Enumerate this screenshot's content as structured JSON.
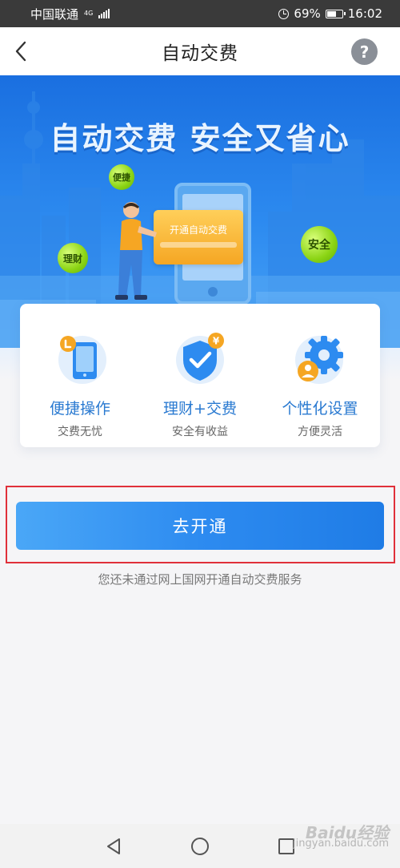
{
  "status_bar": {
    "carrier": "中国联通",
    "network": "4G",
    "battery": "69%",
    "battery_level": 0.69,
    "time": "16:02"
  },
  "header": {
    "title": "自动交费",
    "help_symbol": "?"
  },
  "hero": {
    "headline": "自动交费 安全又省心",
    "card_text": "开通自动交费",
    "bubbles": {
      "convenient": "便捷",
      "finance": "理财",
      "safe": "安全"
    }
  },
  "features": [
    {
      "title": "便捷操作",
      "subtitle": "交费无忧",
      "icon": "phone-icon"
    },
    {
      "title": "理财+交费",
      "subtitle": "安全有收益",
      "icon": "shield-check-icon"
    },
    {
      "title": "个性化设置",
      "subtitle": "方便灵活",
      "icon": "gear-user-icon"
    }
  ],
  "cta": {
    "label": "去开通",
    "notice": "您还未通过网上国网开通自动交费服务"
  },
  "watermark": {
    "brand": "Baidu经验",
    "url": "jingyan.baidu.com"
  },
  "colors": {
    "primary": "#2d8bf0",
    "highlight_frame": "#e0303a",
    "feature_title": "#2a7ad1",
    "bubble_green": "#8bd414",
    "card_gold": "#f5a623"
  }
}
